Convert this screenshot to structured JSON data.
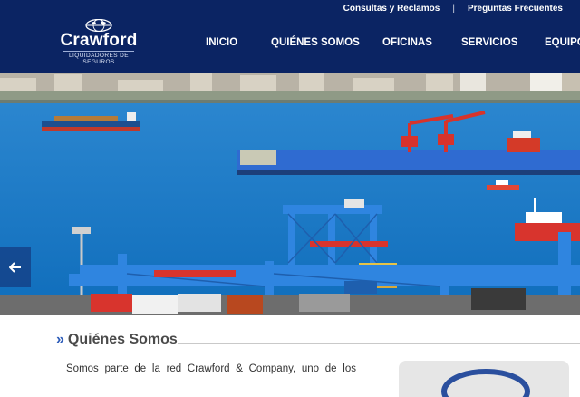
{
  "topbar": {
    "link1": "Consultas y Reclamos",
    "link2": "Preguntas Frecuentes"
  },
  "logo": {
    "brand": "Crawford",
    "subtitle_line1": "LIQUIDADORES DE",
    "subtitle_line2": "SEGUROS"
  },
  "nav": {
    "items": [
      "INICIO",
      "QUIÉNES SOMOS",
      "OFICINAS",
      "SERVICIOS",
      "EQUIPO"
    ]
  },
  "hero": {
    "arrow_icon": "arrow-left-icon"
  },
  "section": {
    "title": "Quiénes Somos",
    "text": "Somos parte de la red Crawford & Company, uno de los"
  },
  "colors": {
    "header_bg": "#0b2463",
    "sea": "#1677c7",
    "crane_blue": "#2e7ad6",
    "crane_red": "#d33a2a",
    "accent_link": "#2a5ab8"
  }
}
